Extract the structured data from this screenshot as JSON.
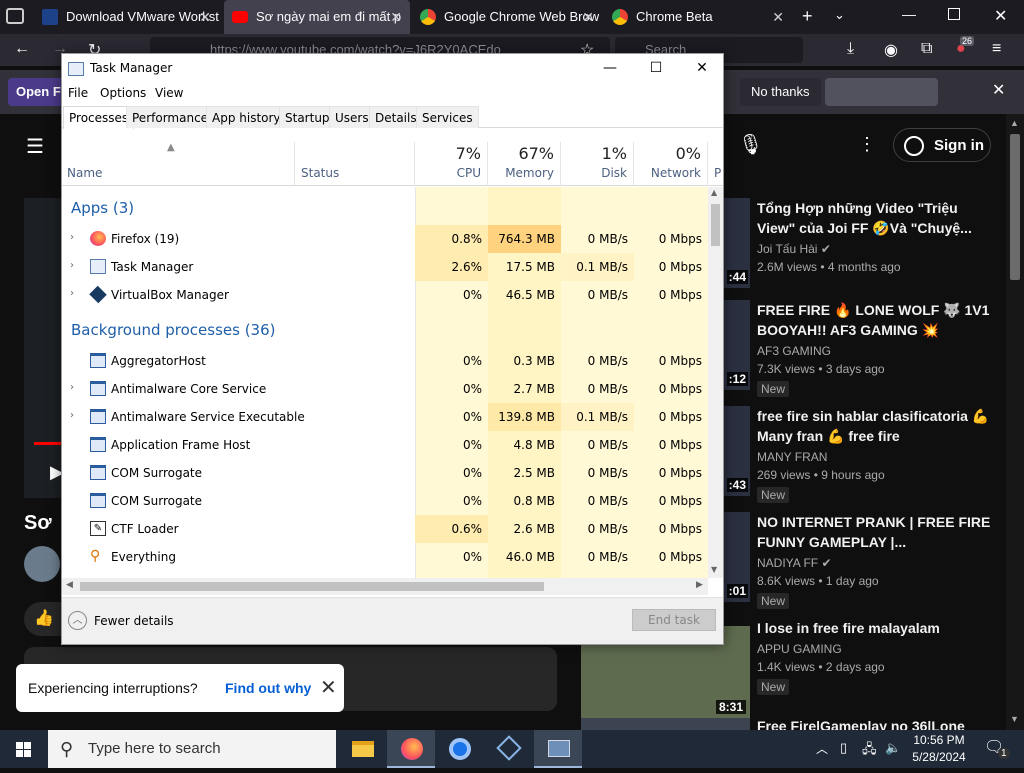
{
  "browser": {
    "tabs": [
      {
        "label": "Download VMware Worksta",
        "favicon_color": "#1d428a"
      },
      {
        "label": "Sơ ngày mai em đi mất p",
        "favicon_color": "#ff0000"
      },
      {
        "label": "Google Chrome Web Brow",
        "favicon_color": "#4285f4"
      },
      {
        "label": "Chrome Beta",
        "favicon_color": "#4285f4"
      }
    ],
    "url": "https://www.youtube.com/watch?v=J6R2Y0ACEdo",
    "search_placeholder": "Search",
    "extension_badge": "26"
  },
  "notification": {
    "open_label": "Open F",
    "no_thanks_label": "No thanks"
  },
  "youtube": {
    "sign_in_label": "Sign in",
    "video_title_partial": "Sơ",
    "interruption_text": "Experiencing interruptions?",
    "interruption_link": "Find out why",
    "recommendations": [
      {
        "title": "Tổng Hợp những Video \"Triệu View\" của Joi FF 🤣Và \"Chuyệ...",
        "channel": "Joi Tấu Hài",
        "verified": true,
        "meta": "2.6M views • 4 months ago",
        "duration": ":44",
        "new": ""
      },
      {
        "title": "FREE FIRE 🔥 LONE WOLF 🐺 1V1 BOOYAH!! AF3 GAMING 💥",
        "channel": "AF3 GAMING",
        "verified": false,
        "meta": "7.3K views • 3 days ago",
        "duration": ":12",
        "new": "New"
      },
      {
        "title": "free fire sin hablar clasificatoria 💪 Many fran 💪 free fire",
        "channel": "MANY FRAN",
        "verified": false,
        "meta": "269 views • 9 hours ago",
        "duration": ":43",
        "new": "New"
      },
      {
        "title": "NO INTERNET PRANK | FREE FIRE FUNNY GAMEPLAY |...",
        "channel": "NADIYA FF",
        "verified": true,
        "meta": "8.6K views • 1 day ago",
        "duration": ":01",
        "new": "New"
      },
      {
        "title": "I lose in free fire malayalam",
        "channel": "APPU GAMING",
        "verified": false,
        "meta": "1.4K views • 2 days ago",
        "duration": "8:31",
        "new": "New"
      },
      {
        "title": "Free Fire|Gameplay no 36|Lone",
        "channel": "",
        "verified": false,
        "meta": "",
        "duration": "",
        "new": ""
      }
    ]
  },
  "task_manager": {
    "title": "Task Manager",
    "menu": [
      "File",
      "Options",
      "View"
    ],
    "tabs": [
      "Processes",
      "Performance",
      "App history",
      "Startup",
      "Users",
      "Details",
      "Services"
    ],
    "columns": {
      "name": "Name",
      "status": "Status",
      "cpu": {
        "pct": "7%",
        "label": "CPU"
      },
      "memory": {
        "pct": "67%",
        "label": "Memory"
      },
      "disk": {
        "pct": "1%",
        "label": "Disk"
      },
      "network": {
        "pct": "0%",
        "label": "Network"
      },
      "next": "P"
    },
    "apps_header": "Apps (3)",
    "bg_header": "Background processes (36)",
    "apps": [
      {
        "name": "Firefox (19)",
        "cpu": "0.8%",
        "memory": "764.3 MB",
        "disk": "0 MB/s",
        "network": "0 Mbps",
        "icon": "firefox-icon"
      },
      {
        "name": "Task Manager",
        "cpu": "2.6%",
        "memory": "17.5 MB",
        "disk": "0.1 MB/s",
        "network": "0 Mbps",
        "icon": "task-manager-icon"
      },
      {
        "name": "VirtualBox Manager",
        "cpu": "0%",
        "memory": "46.5 MB",
        "disk": "0 MB/s",
        "network": "0 Mbps",
        "icon": "virtualbox-icon"
      }
    ],
    "background": [
      {
        "name": "AggregatorHost",
        "cpu": "0%",
        "memory": "0.3 MB",
        "disk": "0 MB/s",
        "network": "0 Mbps",
        "expand": false
      },
      {
        "name": "Antimalware Core Service",
        "cpu": "0%",
        "memory": "2.7 MB",
        "disk": "0 MB/s",
        "network": "0 Mbps",
        "expand": true
      },
      {
        "name": "Antimalware Service Executable",
        "cpu": "0%",
        "memory": "139.8 MB",
        "disk": "0.1 MB/s",
        "network": "0 Mbps",
        "expand": true
      },
      {
        "name": "Application Frame Host",
        "cpu": "0%",
        "memory": "4.8 MB",
        "disk": "0 MB/s",
        "network": "0 Mbps",
        "expand": false
      },
      {
        "name": "COM Surrogate",
        "cpu": "0%",
        "memory": "2.5 MB",
        "disk": "0 MB/s",
        "network": "0 Mbps",
        "expand": false
      },
      {
        "name": "COM Surrogate",
        "cpu": "0%",
        "memory": "0.8 MB",
        "disk": "0 MB/s",
        "network": "0 Mbps",
        "expand": false
      },
      {
        "name": "CTF Loader",
        "cpu": "0.6%",
        "memory": "2.6 MB",
        "disk": "0 MB/s",
        "network": "0 Mbps",
        "expand": false
      },
      {
        "name": "Everything",
        "cpu": "0%",
        "memory": "46.0 MB",
        "disk": "0 MB/s",
        "network": "0 Mbps",
        "expand": false
      }
    ],
    "fewer_details": "Fewer details",
    "end_task": "End task"
  },
  "taskbar": {
    "search_placeholder": "Type here to search",
    "time": "10:56 PM",
    "date": "5/28/2024",
    "notification_count": "1"
  }
}
